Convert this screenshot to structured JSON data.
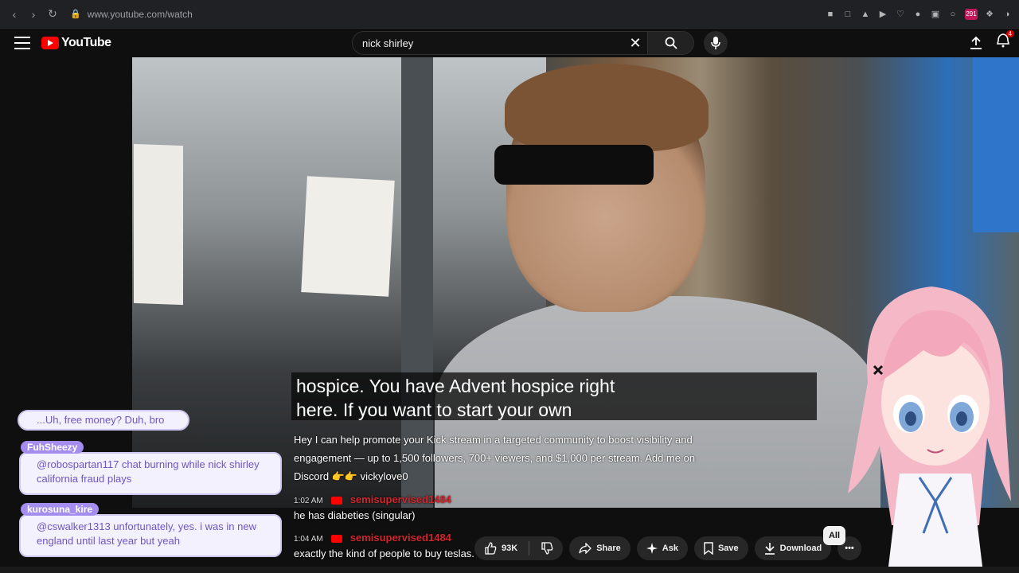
{
  "browser": {
    "url": "www.youtube.com/watch",
    "ext_badge": "291"
  },
  "header": {
    "logo_text": "YouTube",
    "search_query": "nick shirley",
    "notification_count": "4"
  },
  "video": {
    "caption_line1": "hospice. You have Advent hospice right",
    "caption_line2": "here. If you want to start your own"
  },
  "chat_overlay": {
    "promo_text": "Hey I can help promote your Kick stream in a targeted community to boost visibility and engagement — up to 1,500 followers, 700+ viewers, and $1,000 per stream. Add me on Discord 👉👉 vickylove0",
    "messages": [
      {
        "time": "1:02 AM",
        "user": "semisupervised1484",
        "text": "he has diabeties (singular)"
      },
      {
        "time": "1:04 AM",
        "user": "semisupervised1484",
        "text": "exactly the kind of people to buy teslas."
      }
    ]
  },
  "side_chat": {
    "top_pill": "...Uh, free money? Duh, bro",
    "bubbles": [
      {
        "name": "FuhSheezy",
        "text": "@robospartan117 chat burning while nick shirley california fraud plays"
      },
      {
        "name": "kurosuna_kire",
        "text": "@cswalker1313 unfortunately, yes. i was in new england until last year but yeah"
      }
    ]
  },
  "actions": {
    "like_count": "93K",
    "share": "Share",
    "ask": "Ask",
    "save": "Save",
    "download": "Download",
    "more": "•••"
  },
  "chips": {
    "all": "All"
  },
  "colors": {
    "yt_red": "#ff0000",
    "bg": "#0f0f0f",
    "bubble_text": "#6d55c4",
    "nametag": "#a58df0"
  }
}
